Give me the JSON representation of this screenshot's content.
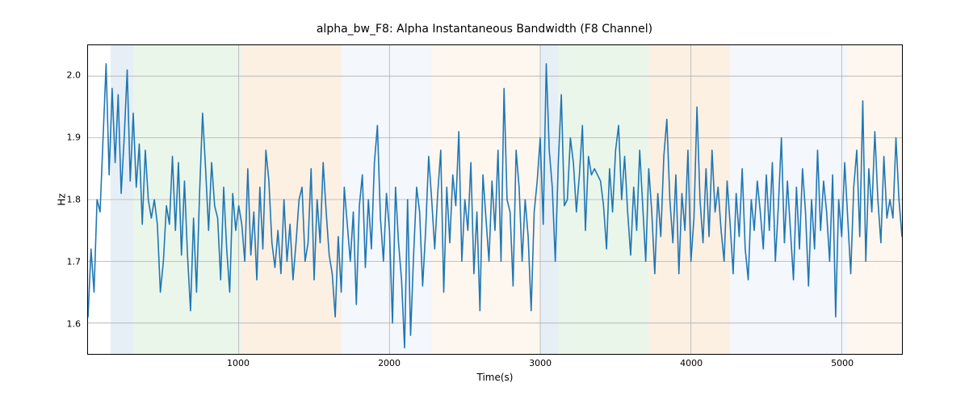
{
  "chart_data": {
    "type": "line",
    "title": "alpha_bw_F8: Alpha Instantaneous Bandwidth (F8 Channel)",
    "xlabel": "Time(s)",
    "ylabel": "Hz",
    "xlim": [
      0,
      5400
    ],
    "ylim": [
      1.55,
      2.05
    ],
    "xticks": [
      1000,
      2000,
      3000,
      4000,
      5000
    ],
    "yticks": [
      1.6,
      1.7,
      1.8,
      1.9,
      2.0
    ],
    "bands": [
      {
        "x0": 150,
        "x1": 300,
        "color": "#a8c6e0"
      },
      {
        "x0": 300,
        "x1": 1020,
        "color": "#b8e0b8"
      },
      {
        "x0": 1020,
        "x1": 1680,
        "color": "#f5c99b"
      },
      {
        "x0": 1680,
        "x1": 2280,
        "color": "#d7e3f4"
      },
      {
        "x0": 2280,
        "x1": 3000,
        "color": "#fbe3c7"
      },
      {
        "x0": 3000,
        "x1": 3120,
        "color": "#a8c6e0"
      },
      {
        "x0": 3120,
        "x1": 3720,
        "color": "#b8e0b8"
      },
      {
        "x0": 3720,
        "x1": 4260,
        "color": "#f5c99b"
      },
      {
        "x0": 4260,
        "x1": 5040,
        "color": "#d7e3f4"
      },
      {
        "x0": 5040,
        "x1": 5400,
        "color": "#fbe3c7"
      }
    ],
    "x": [
      0,
      20,
      40,
      60,
      80,
      100,
      120,
      140,
      160,
      180,
      200,
      220,
      240,
      260,
      280,
      300,
      320,
      340,
      360,
      380,
      400,
      420,
      440,
      460,
      480,
      500,
      520,
      540,
      560,
      580,
      600,
      620,
      640,
      660,
      680,
      700,
      720,
      740,
      760,
      780,
      800,
      820,
      840,
      860,
      880,
      900,
      920,
      940,
      960,
      980,
      1000,
      1020,
      1040,
      1060,
      1080,
      1100,
      1120,
      1140,
      1160,
      1180,
      1200,
      1220,
      1240,
      1260,
      1280,
      1300,
      1320,
      1340,
      1360,
      1380,
      1400,
      1420,
      1440,
      1460,
      1480,
      1500,
      1520,
      1540,
      1560,
      1580,
      1600,
      1620,
      1640,
      1660,
      1680,
      1700,
      1720,
      1740,
      1760,
      1780,
      1800,
      1820,
      1840,
      1860,
      1880,
      1900,
      1920,
      1940,
      1960,
      1980,
      2000,
      2020,
      2040,
      2060,
      2080,
      2100,
      2120,
      2140,
      2160,
      2180,
      2200,
      2220,
      2240,
      2260,
      2280,
      2300,
      2320,
      2340,
      2360,
      2380,
      2400,
      2420,
      2440,
      2460,
      2480,
      2500,
      2520,
      2540,
      2560,
      2580,
      2600,
      2620,
      2640,
      2660,
      2680,
      2700,
      2720,
      2740,
      2760,
      2780,
      2800,
      2820,
      2840,
      2860,
      2880,
      2900,
      2920,
      2940,
      2960,
      2980,
      3000,
      3020,
      3040,
      3060,
      3080,
      3100,
      3120,
      3140,
      3160,
      3180,
      3200,
      3220,
      3240,
      3260,
      3280,
      3300,
      3320,
      3340,
      3360,
      3380,
      3400,
      3420,
      3440,
      3460,
      3480,
      3500,
      3520,
      3540,
      3560,
      3580,
      3600,
      3620,
      3640,
      3660,
      3680,
      3700,
      3720,
      3740,
      3760,
      3780,
      3800,
      3820,
      3840,
      3860,
      3880,
      3900,
      3920,
      3940,
      3960,
      3980,
      4000,
      4020,
      4040,
      4060,
      4080,
      4100,
      4120,
      4140,
      4160,
      4180,
      4200,
      4220,
      4240,
      4260,
      4280,
      4300,
      4320,
      4340,
      4360,
      4380,
      4400,
      4420,
      4440,
      4460,
      4480,
      4500,
      4520,
      4540,
      4560,
      4580,
      4600,
      4620,
      4640,
      4660,
      4680,
      4700,
      4720,
      4740,
      4760,
      4780,
      4800,
      4820,
      4840,
      4860,
      4880,
      4900,
      4920,
      4940,
      4960,
      4980,
      5000,
      5020,
      5040,
      5060,
      5080,
      5100,
      5120,
      5140,
      5160,
      5180,
      5200,
      5220,
      5240,
      5260,
      5280,
      5300,
      5320,
      5340,
      5360,
      5380,
      5400
    ],
    "values": [
      1.61,
      1.72,
      1.65,
      1.8,
      1.78,
      1.9,
      2.02,
      1.84,
      1.98,
      1.86,
      1.97,
      1.81,
      1.9,
      2.01,
      1.83,
      1.94,
      1.82,
      1.89,
      1.76,
      1.88,
      1.8,
      1.77,
      1.8,
      1.76,
      1.65,
      1.7,
      1.79,
      1.76,
      1.87,
      1.75,
      1.86,
      1.71,
      1.83,
      1.71,
      1.62,
      1.77,
      1.65,
      1.81,
      1.94,
      1.85,
      1.75,
      1.86,
      1.79,
      1.77,
      1.67,
      1.82,
      1.72,
      1.65,
      1.81,
      1.75,
      1.79,
      1.76,
      1.7,
      1.85,
      1.71,
      1.78,
      1.67,
      1.82,
      1.72,
      1.88,
      1.83,
      1.73,
      1.69,
      1.75,
      1.68,
      1.8,
      1.7,
      1.76,
      1.67,
      1.73,
      1.8,
      1.82,
      1.7,
      1.73,
      1.85,
      1.67,
      1.8,
      1.73,
      1.86,
      1.78,
      1.71,
      1.68,
      1.61,
      1.74,
      1.65,
      1.82,
      1.76,
      1.7,
      1.78,
      1.63,
      1.79,
      1.84,
      1.69,
      1.8,
      1.72,
      1.86,
      1.92,
      1.77,
      1.7,
      1.81,
      1.75,
      1.6,
      1.82,
      1.73,
      1.67,
      1.56,
      1.8,
      1.58,
      1.71,
      1.82,
      1.78,
      1.66,
      1.75,
      1.87,
      1.8,
      1.72,
      1.81,
      1.88,
      1.65,
      1.82,
      1.73,
      1.84,
      1.79,
      1.91,
      1.7,
      1.8,
      1.75,
      1.86,
      1.68,
      1.78,
      1.62,
      1.84,
      1.77,
      1.7,
      1.83,
      1.75,
      1.88,
      1.7,
      1.98,
      1.8,
      1.78,
      1.66,
      1.88,
      1.82,
      1.7,
      1.8,
      1.74,
      1.62,
      1.78,
      1.83,
      1.9,
      1.76,
      2.02,
      1.88,
      1.82,
      1.7,
      1.86,
      1.97,
      1.79,
      1.8,
      1.9,
      1.86,
      1.78,
      1.84,
      1.92,
      1.75,
      1.87,
      1.84,
      1.85,
      1.84,
      1.83,
      1.79,
      1.72,
      1.85,
      1.78,
      1.88,
      1.92,
      1.8,
      1.87,
      1.78,
      1.71,
      1.82,
      1.75,
      1.88,
      1.79,
      1.7,
      1.85,
      1.78,
      1.68,
      1.81,
      1.74,
      1.87,
      1.93,
      1.8,
      1.73,
      1.84,
      1.68,
      1.81,
      1.75,
      1.88,
      1.7,
      1.77,
      1.95,
      1.8,
      1.73,
      1.85,
      1.74,
      1.88,
      1.78,
      1.82,
      1.75,
      1.7,
      1.83,
      1.76,
      1.68,
      1.81,
      1.74,
      1.85,
      1.72,
      1.67,
      1.8,
      1.75,
      1.83,
      1.78,
      1.72,
      1.84,
      1.75,
      1.86,
      1.7,
      1.79,
      1.9,
      1.73,
      1.83,
      1.75,
      1.67,
      1.82,
      1.72,
      1.85,
      1.78,
      1.66,
      1.8,
      1.72,
      1.88,
      1.75,
      1.83,
      1.78,
      1.7,
      1.84,
      1.61,
      1.8,
      1.74,
      1.86,
      1.77,
      1.68,
      1.82,
      1.88,
      1.74,
      1.96,
      1.7,
      1.85,
      1.78,
      1.91,
      1.8,
      1.73,
      1.87,
      1.77,
      1.8,
      1.77,
      1.9,
      1.8,
      1.74
    ]
  }
}
